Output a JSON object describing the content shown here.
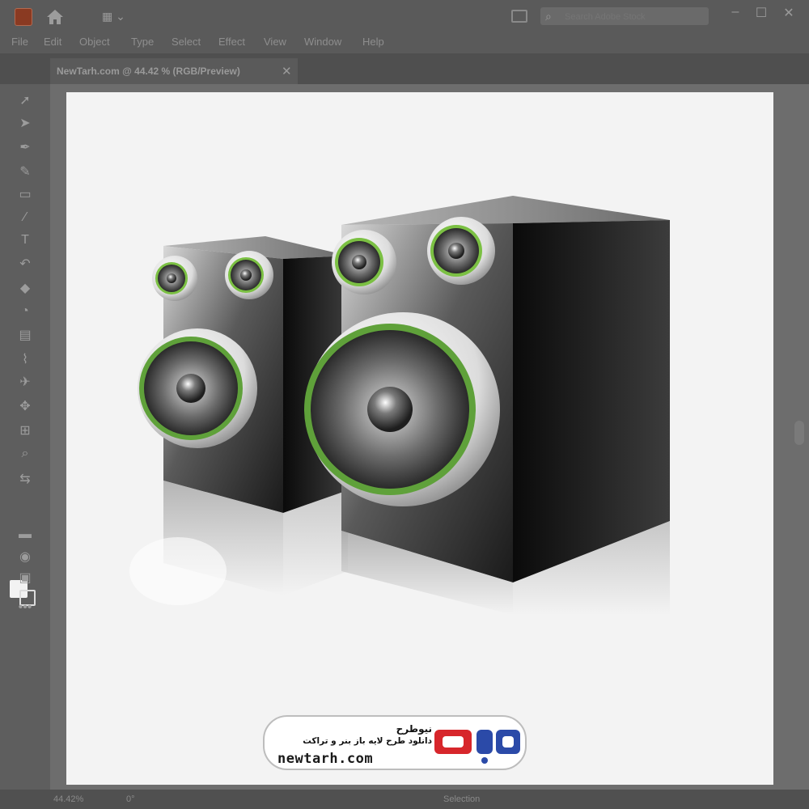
{
  "window": {
    "search_placeholder": "Search Adobe Stock",
    "minimize_glyph": "–",
    "maximize_glyph": "☐",
    "close_glyph": "✕"
  },
  "menu": {
    "items": [
      "File",
      "Edit",
      "Object",
      "Type",
      "Select",
      "Effect",
      "View",
      "Window",
      "Help"
    ]
  },
  "document": {
    "tab_label": "NewTarh.com @ 44.42 % (RGB/Preview)",
    "close_glyph": "✕"
  },
  "status": {
    "zoom": "44.42%",
    "angle": "0°",
    "tool": "Selection"
  },
  "watermark": {
    "title": "نیوطرح",
    "subtitle": "دانلود طرح لایه باز بنر و تراکت",
    "url": "newtarh.com",
    "logo_text": "نیوطرح"
  },
  "colors": {
    "accent_green": "#7bc043",
    "logo_red": "#d7262b",
    "logo_blue": "#2b4aa8"
  },
  "icons": {
    "app": "adobe-illustrator-icon",
    "home": "home-icon",
    "layout": "workspace-layout-icon",
    "panel": "panel-icon",
    "search": "search-icon"
  }
}
